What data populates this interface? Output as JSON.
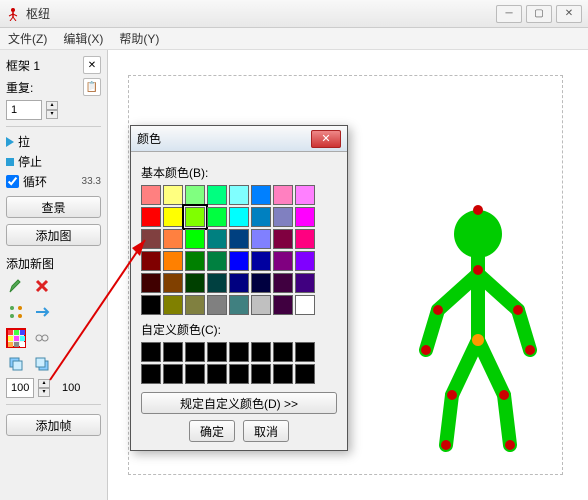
{
  "window": {
    "title": "枢纽"
  },
  "menu": {
    "file": "文件(Z)",
    "edit": "编辑(X)",
    "help": "帮助(Y)"
  },
  "sidebar": {
    "frame_label": "框架 1",
    "repeat_label": "重复:",
    "repeat_value": "1",
    "play": "拉",
    "stop": "停止",
    "loop": "循环",
    "fps": "33.3",
    "bg_btn": "查景",
    "addimg_btn": "添加图",
    "addnew_label": "添加新图",
    "scale_a": "100",
    "scale_b": "100",
    "addframe_btn": "添加帧"
  },
  "dialog": {
    "title": "颜色",
    "basic_label": "基本颜色(B):",
    "custom_label": "自定义颜色(C):",
    "define_btn": "规定自定义颜色(D) >>",
    "ok": "确定",
    "cancel": "取消",
    "basic_colors": [
      "#ff8080",
      "#ffff80",
      "#80ff80",
      "#00ff80",
      "#80ffff",
      "#0080ff",
      "#ff80c0",
      "#ff80ff",
      "#ff0000",
      "#ffff00",
      "#80ff00",
      "#00ff40",
      "#00ffff",
      "#0080c0",
      "#8080c0",
      "#ff00ff",
      "#804040",
      "#ff8040",
      "#00ff00",
      "#008080",
      "#004080",
      "#8080ff",
      "#800040",
      "#ff0080",
      "#800000",
      "#ff8000",
      "#008000",
      "#008040",
      "#0000ff",
      "#0000a0",
      "#800080",
      "#8000ff",
      "#400000",
      "#804000",
      "#004000",
      "#004040",
      "#000080",
      "#000040",
      "#400040",
      "#400080",
      "#000000",
      "#808000",
      "#808040",
      "#808080",
      "#408080",
      "#c0c0c0",
      "#400040",
      "#ffffff"
    ],
    "selected_index": 10
  }
}
